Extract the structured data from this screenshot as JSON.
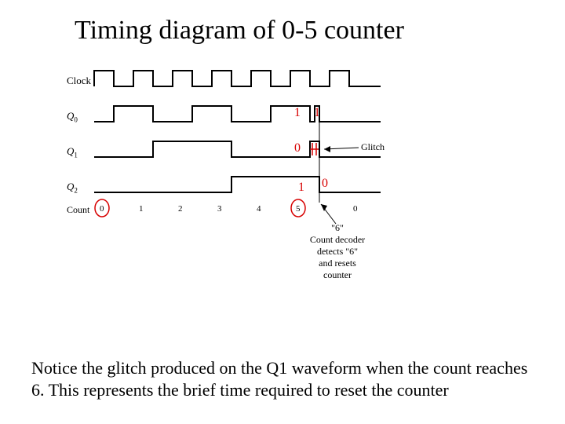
{
  "title": "Timing diagram of 0-5 counter",
  "signals": {
    "clock": "Clock",
    "q0_base": "Q",
    "q0_sub": "0",
    "q1_base": "Q",
    "q1_sub": "1",
    "q2_base": "Q",
    "q2_sub": "2"
  },
  "count_label": "Count",
  "counts": [
    "0",
    "1",
    "2",
    "3",
    "4",
    "5",
    "0"
  ],
  "glitch_label": "Glitch",
  "decoder_line1": "\"6\"",
  "decoder_line2": "Count decoder",
  "decoder_line3": "detects \"6\"",
  "decoder_line4": "and resets",
  "decoder_line5": "counter",
  "red": {
    "q0_a": "1",
    "q0_b": "1",
    "q1_a": "0",
    "q2_a": "1",
    "q2_b": "0"
  },
  "caption": "Notice the glitch produced on the Q1 waveform when the count reaches 6.  This represents the brief time required to reset the counter",
  "chart_data": {
    "type": "timing-diagram",
    "title": "Timing diagram of 0-5 counter",
    "period_units": 7,
    "signals": [
      {
        "name": "Clock",
        "type": "clock",
        "periods": 7
      },
      {
        "name": "Q0",
        "transitions": [
          0,
          1,
          0,
          1,
          0,
          1,
          "glitch",
          0
        ],
        "note": "toggles each clock; brief glitch at count 6 then resets"
      },
      {
        "name": "Q1",
        "transitions": [
          0,
          0,
          1,
          1,
          0,
          0,
          "glitch",
          0
        ],
        "note": "glitch high at count 6"
      },
      {
        "name": "Q2",
        "transitions": [
          0,
          0,
          0,
          0,
          1,
          1,
          "glitch",
          0
        ]
      }
    ],
    "count_sequence": [
      0,
      1,
      2,
      3,
      4,
      5,
      0
    ],
    "annotations": [
      {
        "text": "Glitch",
        "target": "Q1 at count 6"
      },
      {
        "text": "Count decoder detects \"6\" and resets counter",
        "target": "after count 5"
      }
    ]
  }
}
